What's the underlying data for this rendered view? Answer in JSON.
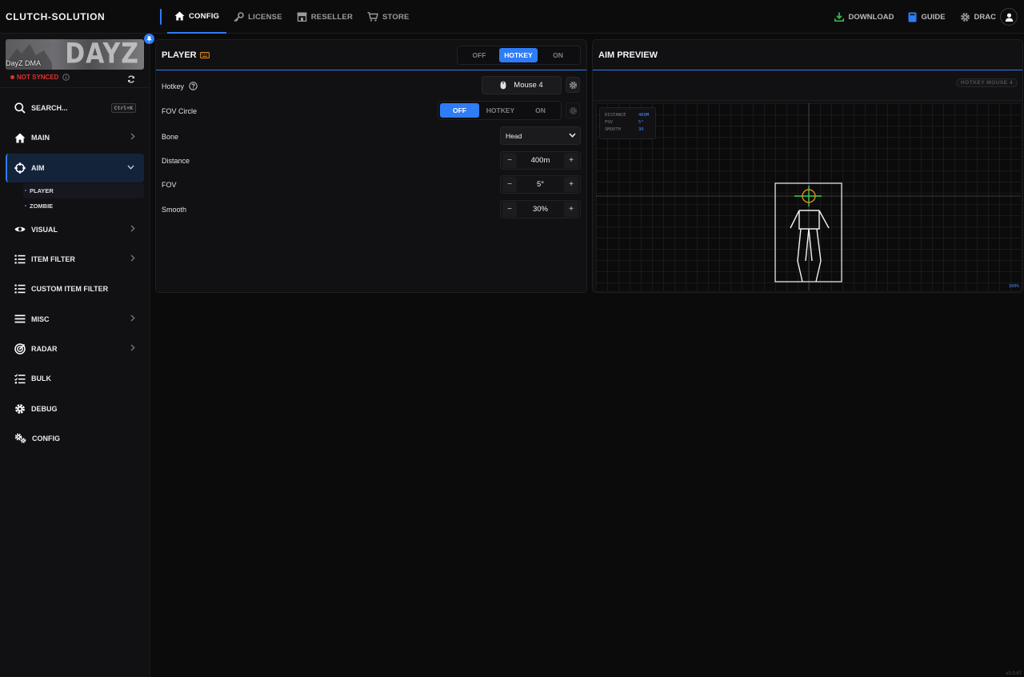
{
  "app": {
    "brand": "CLUTCH-SOLUTION",
    "version": "v3.0.67"
  },
  "topnav": [
    {
      "label": "CONFIG",
      "icon": "home-icon",
      "active": true
    },
    {
      "label": "LICENSE",
      "icon": "key-icon"
    },
    {
      "label": "RESELLER",
      "icon": "store-icon"
    },
    {
      "label": "STORE",
      "icon": "cart-icon"
    }
  ],
  "rightnav": {
    "download": "DOWNLOAD",
    "guide": "GUIDE",
    "user": "DRAC"
  },
  "colors": {
    "accent": "#2e7cf6",
    "status_red": "#e0322f",
    "download_green": "#3fae4a",
    "crosshair_green": "#3fcf4a",
    "fov_orange": "#e08a1e",
    "stat_blue": "#4a8cff"
  },
  "sidebar": {
    "game_name": "DayZ DMA",
    "banner_logo": "DAYZ",
    "sync_status": "NOT SYNCED",
    "search": {
      "label": "SEARCH...",
      "shortcut": "Ctrl+K"
    },
    "items": [
      {
        "label": "MAIN",
        "icon": "home-icon",
        "chevron": true
      },
      {
        "label": "AIM",
        "icon": "crosshair-icon",
        "chevron": true,
        "active": true
      },
      {
        "label": "VISUAL",
        "icon": "eye-icon",
        "chevron": true
      },
      {
        "label": "ITEM FILTER",
        "icon": "list-icon",
        "chevron": true
      },
      {
        "label": "CUSTOM ITEM FILTER",
        "icon": "list-icon",
        "chevron": false
      },
      {
        "label": "MISC",
        "icon": "menu-icon",
        "chevron": true
      },
      {
        "label": "RADAR",
        "icon": "radar-icon",
        "chevron": true
      },
      {
        "label": "BULK",
        "icon": "checklist-icon",
        "chevron": false
      },
      {
        "label": "DEBUG",
        "icon": "gear-icon",
        "chevron": false
      },
      {
        "label": "CONFIG",
        "icon": "gears-icon",
        "chevron": false
      }
    ],
    "aim_sub": [
      {
        "label": "PLAYER",
        "active": true
      },
      {
        "label": "ZOMBIE"
      }
    ]
  },
  "player_panel": {
    "title": "PLAYER",
    "mode": {
      "options": [
        "OFF",
        "HOTKEY",
        "ON"
      ],
      "selected": "HOTKEY"
    },
    "hotkey": {
      "label": "Hotkey",
      "value": "Mouse 4"
    },
    "fov_circle": {
      "label": "FOV Circle",
      "options": [
        "OFF",
        "HOTKEY",
        "ON"
      ],
      "selected": "OFF"
    },
    "bone": {
      "label": "Bone",
      "value": "Head"
    },
    "distance": {
      "label": "Distance",
      "value": "400m"
    },
    "fov": {
      "label": "FOV",
      "value": "5°"
    },
    "smooth": {
      "label": "Smooth",
      "value": "30%"
    }
  },
  "aim_preview": {
    "title": "AIM PREVIEW",
    "chip": "HOTKEY MOUSE 4",
    "stats": [
      {
        "key": "DISTANCE",
        "value": "400M"
      },
      {
        "key": "FOV",
        "value": "5°"
      },
      {
        "key": "SMOOTH",
        "value": "30"
      }
    ],
    "zoom": "100%"
  }
}
